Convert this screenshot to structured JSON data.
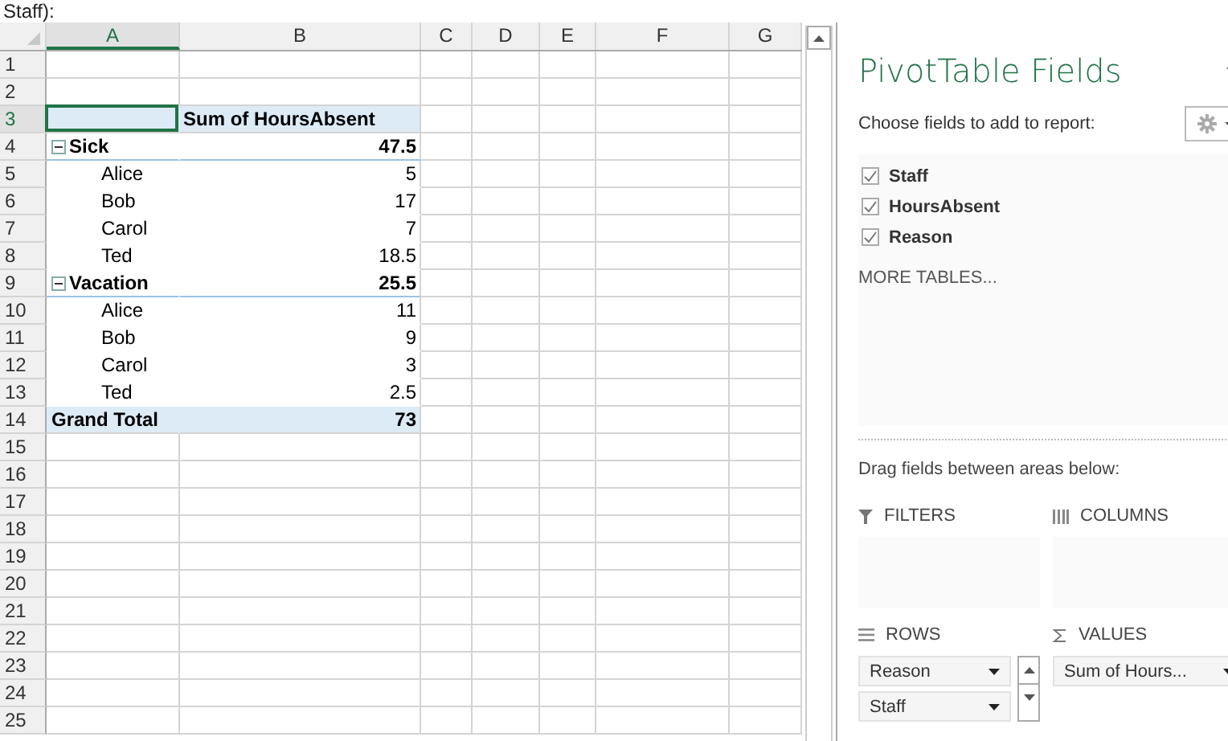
{
  "caption": "Staff):",
  "sheet": {
    "column_headers": [
      {
        "label": "A",
        "selected": true
      },
      {
        "label": "B",
        "selected": false
      },
      {
        "label": "C",
        "selected": false
      },
      {
        "label": "D",
        "selected": false
      },
      {
        "label": "E",
        "selected": false
      },
      {
        "label": "F",
        "selected": false
      },
      {
        "label": "G",
        "selected": false
      }
    ],
    "row_numbers": [
      {
        "label": "1",
        "selected": false
      },
      {
        "label": "2",
        "selected": false
      },
      {
        "label": "3",
        "selected": true
      },
      {
        "label": "4",
        "selected": false
      },
      {
        "label": "5",
        "selected": false
      },
      {
        "label": "6",
        "selected": false
      },
      {
        "label": "7",
        "selected": false
      },
      {
        "label": "8",
        "selected": false
      },
      {
        "label": "9",
        "selected": false
      },
      {
        "label": "10",
        "selected": false
      },
      {
        "label": "11",
        "selected": false
      },
      {
        "label": "12",
        "selected": false
      },
      {
        "label": "13",
        "selected": false
      },
      {
        "label": "14",
        "selected": false
      },
      {
        "label": "15",
        "selected": false
      },
      {
        "label": "16",
        "selected": false
      },
      {
        "label": "17",
        "selected": false
      },
      {
        "label": "18",
        "selected": false
      },
      {
        "label": "19",
        "selected": false
      },
      {
        "label": "20",
        "selected": false
      },
      {
        "label": "21",
        "selected": false
      },
      {
        "label": "22",
        "selected": false
      },
      {
        "label": "23",
        "selected": false
      },
      {
        "label": "24",
        "selected": false
      },
      {
        "label": "25",
        "selected": false
      }
    ]
  },
  "pivot": {
    "value_header": "Sum of HoursAbsent",
    "groups": [
      {
        "label": "Sick",
        "total": "47.5",
        "expanded": true,
        "children": [
          {
            "label": "Alice",
            "value": "5"
          },
          {
            "label": "Bob",
            "value": "17"
          },
          {
            "label": "Carol",
            "value": "7"
          },
          {
            "label": "Ted",
            "value": "18.5"
          }
        ]
      },
      {
        "label": "Vacation",
        "total": "25.5",
        "expanded": true,
        "children": [
          {
            "label": "Alice",
            "value": "11"
          },
          {
            "label": "Bob",
            "value": "9"
          },
          {
            "label": "Carol",
            "value": "3"
          },
          {
            "label": "Ted",
            "value": "2.5"
          }
        ]
      }
    ],
    "grand_total": {
      "label": "Grand Total",
      "value": "73"
    }
  },
  "panel": {
    "title": "PivotTable Fields",
    "prompt": "Choose fields to add to report:",
    "fields": [
      {
        "label": "Staff",
        "checked": true
      },
      {
        "label": "HoursAbsent",
        "checked": true
      },
      {
        "label": "Reason",
        "checked": true
      }
    ],
    "more_tables": "MORE TABLES...",
    "drag_hint": "Drag fields between areas below:",
    "areas": [
      {
        "kind": "filters",
        "label": "FILTERS"
      },
      {
        "kind": "columns",
        "label": "COLUMNS"
      },
      {
        "kind": "rows",
        "label": "ROWS",
        "items": [
          "Reason",
          "Staff"
        ]
      },
      {
        "kind": "values",
        "label": "VALUES",
        "items": [
          "Sum of Hours..."
        ]
      }
    ]
  }
}
